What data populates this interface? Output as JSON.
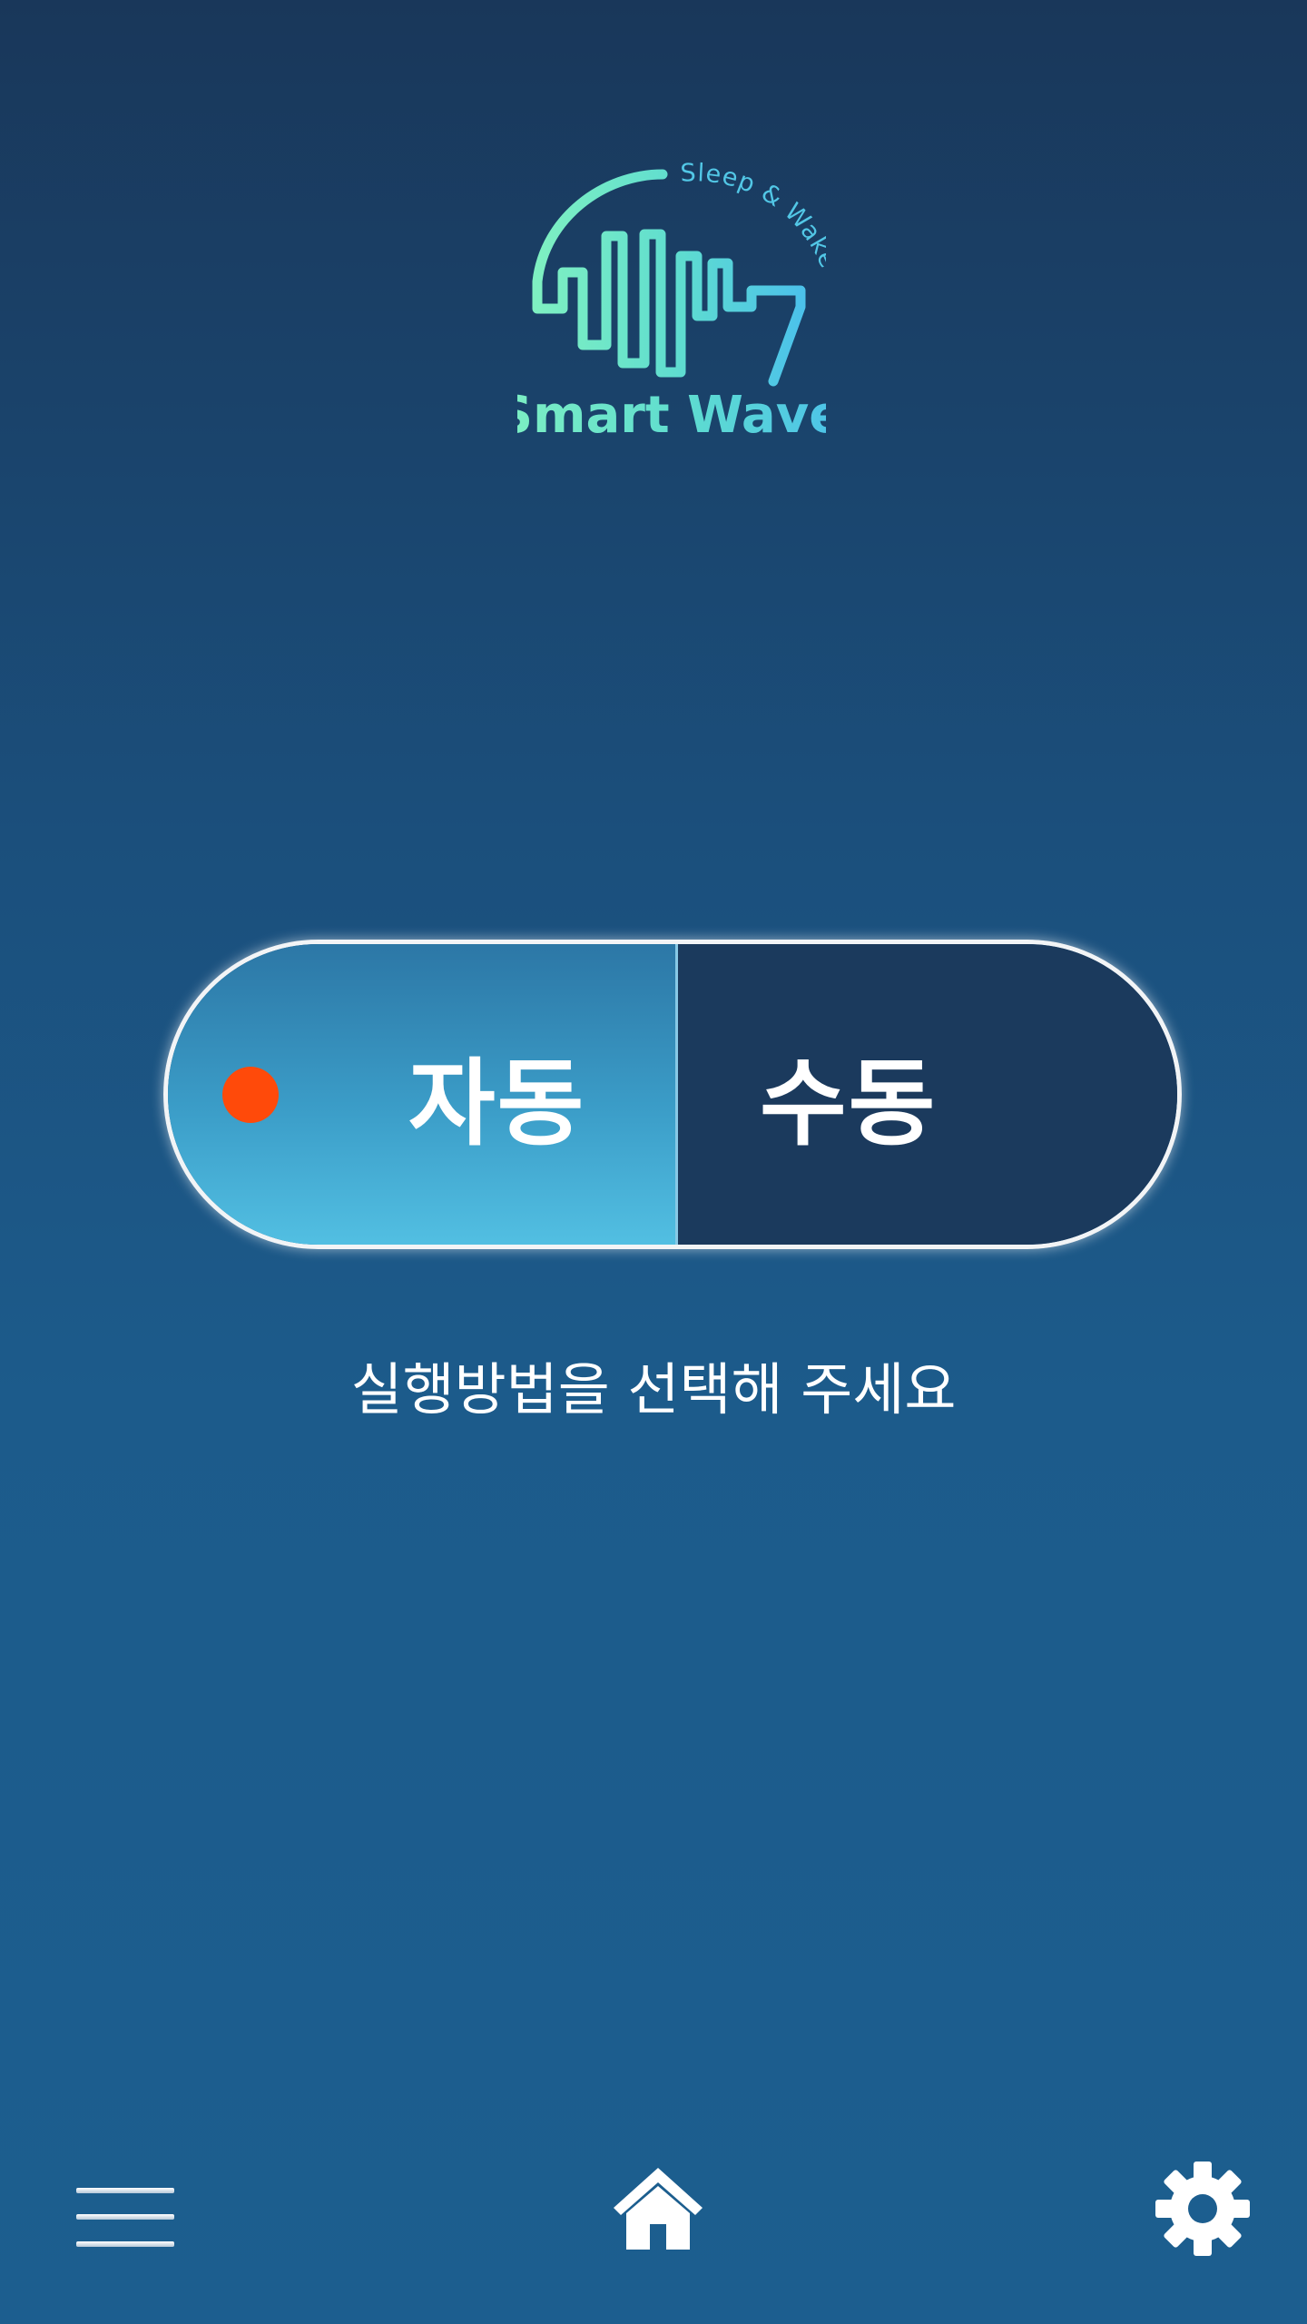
{
  "logo": {
    "brand": "Smart Wave",
    "tagline": "Sleep & Wake"
  },
  "mode_toggle": {
    "auto_label": "자동",
    "manual_label": "수동",
    "selected": "자동"
  },
  "instruction": "실행방법을 선택해 주세요",
  "bottom_nav": {
    "left_icon": "menu-icon",
    "center_icon": "home-icon",
    "right_icon": "gear-icon"
  },
  "colors": {
    "background_top": "#19375a",
    "background_bottom": "#1c5e8f",
    "auto_segment": "#3b9dc8",
    "manual_segment": "#1b3a5d",
    "indicator": "#ff4a0a",
    "logo_mint": "#6fe6c4",
    "logo_cyan": "#4fc6e6"
  }
}
